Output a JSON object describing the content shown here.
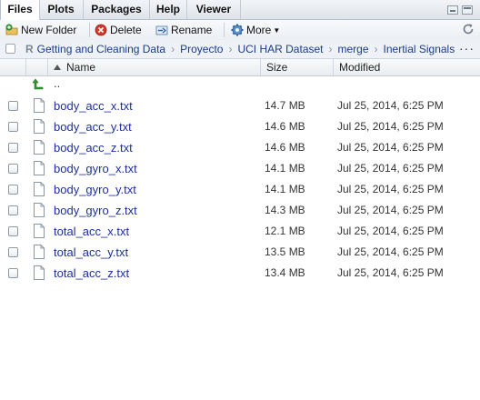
{
  "tabs": [
    {
      "label": "Files",
      "active": true
    },
    {
      "label": "Plots",
      "active": false
    },
    {
      "label": "Packages",
      "active": false
    },
    {
      "label": "Help",
      "active": false
    },
    {
      "label": "Viewer",
      "active": false
    }
  ],
  "toolbar": {
    "new_folder_label": "New Folder",
    "delete_label": "Delete",
    "rename_label": "Rename",
    "more_label": "More"
  },
  "breadcrumb": {
    "root_glyph": "R",
    "items": [
      "Getting and Cleaning Data",
      "Proyecto",
      "UCI HAR Dataset",
      "merge",
      "Inertial Signals"
    ],
    "separator": "›",
    "more_glyph": "···"
  },
  "columns": {
    "name": "Name",
    "size": "Size",
    "modified": "Modified"
  },
  "parent_row": {
    "name": ".."
  },
  "files": [
    {
      "name": "body_acc_x.txt",
      "size": "14.7 MB",
      "modified": "Jul 25, 2014, 6:25 PM"
    },
    {
      "name": "body_acc_y.txt",
      "size": "14.6 MB",
      "modified": "Jul 25, 2014, 6:25 PM"
    },
    {
      "name": "body_acc_z.txt",
      "size": "14.6 MB",
      "modified": "Jul 25, 2014, 6:25 PM"
    },
    {
      "name": "body_gyro_x.txt",
      "size": "14.1 MB",
      "modified": "Jul 25, 2014, 6:25 PM"
    },
    {
      "name": "body_gyro_y.txt",
      "size": "14.1 MB",
      "modified": "Jul 25, 2014, 6:25 PM"
    },
    {
      "name": "body_gyro_z.txt",
      "size": "14.3 MB",
      "modified": "Jul 25, 2014, 6:25 PM"
    },
    {
      "name": "total_acc_x.txt",
      "size": "12.1 MB",
      "modified": "Jul 25, 2014, 6:25 PM"
    },
    {
      "name": "total_acc_y.txt",
      "size": "13.5 MB",
      "modified": "Jul 25, 2014, 6:25 PM"
    },
    {
      "name": "total_acc_z.txt",
      "size": "13.4 MB",
      "modified": "Jul 25, 2014, 6:25 PM"
    }
  ],
  "colors": {
    "link": "#1d2fa0",
    "up_arrow": "#2f9a2f",
    "delete_red": "#d23a2a"
  }
}
